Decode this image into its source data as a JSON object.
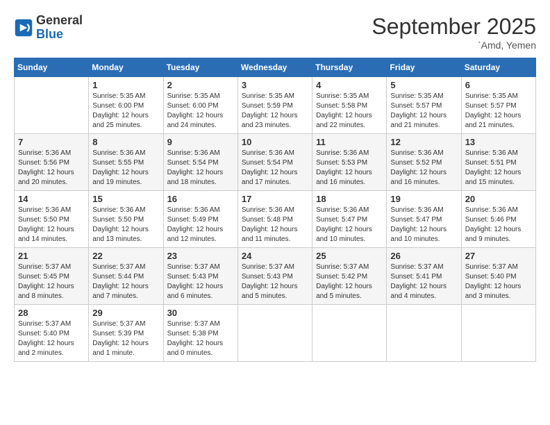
{
  "header": {
    "logo_line1": "General",
    "logo_line2": "Blue",
    "month": "September 2025",
    "location": "`Amd, Yemen"
  },
  "weekdays": [
    "Sunday",
    "Monday",
    "Tuesday",
    "Wednesday",
    "Thursday",
    "Friday",
    "Saturday"
  ],
  "weeks": [
    [
      {
        "day": "",
        "sunrise": "",
        "sunset": "",
        "daylight": ""
      },
      {
        "day": "1",
        "sunrise": "Sunrise: 5:35 AM",
        "sunset": "Sunset: 6:00 PM",
        "daylight": "Daylight: 12 hours and 25 minutes."
      },
      {
        "day": "2",
        "sunrise": "Sunrise: 5:35 AM",
        "sunset": "Sunset: 6:00 PM",
        "daylight": "Daylight: 12 hours and 24 minutes."
      },
      {
        "day": "3",
        "sunrise": "Sunrise: 5:35 AM",
        "sunset": "Sunset: 5:59 PM",
        "daylight": "Daylight: 12 hours and 23 minutes."
      },
      {
        "day": "4",
        "sunrise": "Sunrise: 5:35 AM",
        "sunset": "Sunset: 5:58 PM",
        "daylight": "Daylight: 12 hours and 22 minutes."
      },
      {
        "day": "5",
        "sunrise": "Sunrise: 5:35 AM",
        "sunset": "Sunset: 5:57 PM",
        "daylight": "Daylight: 12 hours and 21 minutes."
      },
      {
        "day": "6",
        "sunrise": "Sunrise: 5:35 AM",
        "sunset": "Sunset: 5:57 PM",
        "daylight": "Daylight: 12 hours and 21 minutes."
      }
    ],
    [
      {
        "day": "7",
        "sunrise": "Sunrise: 5:36 AM",
        "sunset": "Sunset: 5:56 PM",
        "daylight": "Daylight: 12 hours and 20 minutes."
      },
      {
        "day": "8",
        "sunrise": "Sunrise: 5:36 AM",
        "sunset": "Sunset: 5:55 PM",
        "daylight": "Daylight: 12 hours and 19 minutes."
      },
      {
        "day": "9",
        "sunrise": "Sunrise: 5:36 AM",
        "sunset": "Sunset: 5:54 PM",
        "daylight": "Daylight: 12 hours and 18 minutes."
      },
      {
        "day": "10",
        "sunrise": "Sunrise: 5:36 AM",
        "sunset": "Sunset: 5:54 PM",
        "daylight": "Daylight: 12 hours and 17 minutes."
      },
      {
        "day": "11",
        "sunrise": "Sunrise: 5:36 AM",
        "sunset": "Sunset: 5:53 PM",
        "daylight": "Daylight: 12 hours and 16 minutes."
      },
      {
        "day": "12",
        "sunrise": "Sunrise: 5:36 AM",
        "sunset": "Sunset: 5:52 PM",
        "daylight": "Daylight: 12 hours and 16 minutes."
      },
      {
        "day": "13",
        "sunrise": "Sunrise: 5:36 AM",
        "sunset": "Sunset: 5:51 PM",
        "daylight": "Daylight: 12 hours and 15 minutes."
      }
    ],
    [
      {
        "day": "14",
        "sunrise": "Sunrise: 5:36 AM",
        "sunset": "Sunset: 5:50 PM",
        "daylight": "Daylight: 12 hours and 14 minutes."
      },
      {
        "day": "15",
        "sunrise": "Sunrise: 5:36 AM",
        "sunset": "Sunset: 5:50 PM",
        "daylight": "Daylight: 12 hours and 13 minutes."
      },
      {
        "day": "16",
        "sunrise": "Sunrise: 5:36 AM",
        "sunset": "Sunset: 5:49 PM",
        "daylight": "Daylight: 12 hours and 12 minutes."
      },
      {
        "day": "17",
        "sunrise": "Sunrise: 5:36 AM",
        "sunset": "Sunset: 5:48 PM",
        "daylight": "Daylight: 12 hours and 11 minutes."
      },
      {
        "day": "18",
        "sunrise": "Sunrise: 5:36 AM",
        "sunset": "Sunset: 5:47 PM",
        "daylight": "Daylight: 12 hours and 10 minutes."
      },
      {
        "day": "19",
        "sunrise": "Sunrise: 5:36 AM",
        "sunset": "Sunset: 5:47 PM",
        "daylight": "Daylight: 12 hours and 10 minutes."
      },
      {
        "day": "20",
        "sunrise": "Sunrise: 5:36 AM",
        "sunset": "Sunset: 5:46 PM",
        "daylight": "Daylight: 12 hours and 9 minutes."
      }
    ],
    [
      {
        "day": "21",
        "sunrise": "Sunrise: 5:37 AM",
        "sunset": "Sunset: 5:45 PM",
        "daylight": "Daylight: 12 hours and 8 minutes."
      },
      {
        "day": "22",
        "sunrise": "Sunrise: 5:37 AM",
        "sunset": "Sunset: 5:44 PM",
        "daylight": "Daylight: 12 hours and 7 minutes."
      },
      {
        "day": "23",
        "sunrise": "Sunrise: 5:37 AM",
        "sunset": "Sunset: 5:43 PM",
        "daylight": "Daylight: 12 hours and 6 minutes."
      },
      {
        "day": "24",
        "sunrise": "Sunrise: 5:37 AM",
        "sunset": "Sunset: 5:43 PM",
        "daylight": "Daylight: 12 hours and 5 minutes."
      },
      {
        "day": "25",
        "sunrise": "Sunrise: 5:37 AM",
        "sunset": "Sunset: 5:42 PM",
        "daylight": "Daylight: 12 hours and 5 minutes."
      },
      {
        "day": "26",
        "sunrise": "Sunrise: 5:37 AM",
        "sunset": "Sunset: 5:41 PM",
        "daylight": "Daylight: 12 hours and 4 minutes."
      },
      {
        "day": "27",
        "sunrise": "Sunrise: 5:37 AM",
        "sunset": "Sunset: 5:40 PM",
        "daylight": "Daylight: 12 hours and 3 minutes."
      }
    ],
    [
      {
        "day": "28",
        "sunrise": "Sunrise: 5:37 AM",
        "sunset": "Sunset: 5:40 PM",
        "daylight": "Daylight: 12 hours and 2 minutes."
      },
      {
        "day": "29",
        "sunrise": "Sunrise: 5:37 AM",
        "sunset": "Sunset: 5:39 PM",
        "daylight": "Daylight: 12 hours and 1 minute."
      },
      {
        "day": "30",
        "sunrise": "Sunrise: 5:37 AM",
        "sunset": "Sunset: 5:38 PM",
        "daylight": "Daylight: 12 hours and 0 minutes."
      },
      {
        "day": "",
        "sunrise": "",
        "sunset": "",
        "daylight": ""
      },
      {
        "day": "",
        "sunrise": "",
        "sunset": "",
        "daylight": ""
      },
      {
        "day": "",
        "sunrise": "",
        "sunset": "",
        "daylight": ""
      },
      {
        "day": "",
        "sunrise": "",
        "sunset": "",
        "daylight": ""
      }
    ]
  ]
}
